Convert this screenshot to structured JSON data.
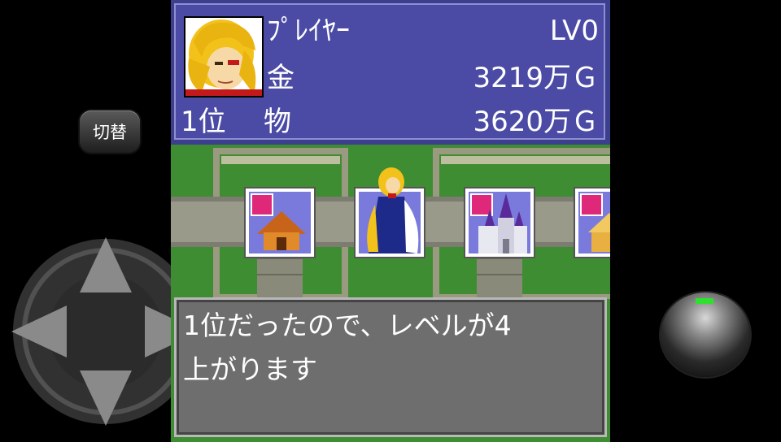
{
  "controls": {
    "switch_label": "切替",
    "dpad_icons": [
      "arrow-up-icon",
      "arrow-down-icon",
      "arrow-left-icon",
      "arrow-right-icon"
    ]
  },
  "status": {
    "player_name": "ﾌﾟﾚｲﾔｰ",
    "level": "LV0",
    "money_label": "金",
    "money_value": "3219万Ｇ",
    "rank": "1位",
    "assets_label": "物",
    "assets_value": "3620万Ｇ"
  },
  "board": {
    "tiles": [
      {
        "icon": "sword-icon",
        "building": "house-icon"
      },
      {
        "icon": "",
        "building": "angel-icon"
      },
      {
        "icon": "bed-icon",
        "building": "castle-icon"
      },
      {
        "icon": "bed-icon",
        "building": "temple-icon"
      }
    ]
  },
  "message": {
    "line1": "1位だったので、レベルが4",
    "line2": "上がります"
  },
  "colors": {
    "status_bg": "#4b4ba6",
    "grass": "#3f8d32",
    "message_bg": "#6e6e6e",
    "led": "#2fe02f"
  }
}
